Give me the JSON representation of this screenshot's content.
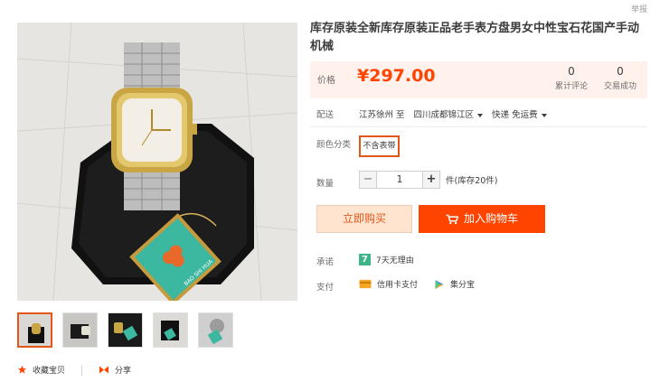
{
  "header": {
    "report_label": "举报"
  },
  "product": {
    "title": "库存原装全新库存原装正品老手表方盘男女中性宝石花国产手动机械",
    "price_label": "价格",
    "price": "¥297.00",
    "reviews": {
      "count": "0",
      "label": "累计评论"
    },
    "sales": {
      "count": "0",
      "label": "交易成功"
    },
    "tag_text": "BAO SHI HUA"
  },
  "delivery": {
    "label": "配送",
    "from": "江苏徐州 至",
    "to": "四川成都锦江区",
    "shipping": "快递 免运费"
  },
  "color": {
    "label": "颜色分类",
    "option": "不含表带"
  },
  "quantity": {
    "label": "数量",
    "minus": "−",
    "value": "1",
    "plus": "+",
    "stock": "件(库存20件)"
  },
  "actions": {
    "buy_now": "立即购买",
    "add_cart": "加入购物车"
  },
  "promise": {
    "label": "承诺",
    "badge": "7",
    "text": "7天无理由"
  },
  "payment": {
    "label": "支付",
    "credit": "信用卡支付",
    "huabei": "集分宝"
  },
  "social": {
    "favorite": "收藏宝贝",
    "share": "分享"
  },
  "colors": {
    "accent": "#ff4400",
    "border_active": "#e4571b",
    "price_bg": "#fff2ec"
  }
}
